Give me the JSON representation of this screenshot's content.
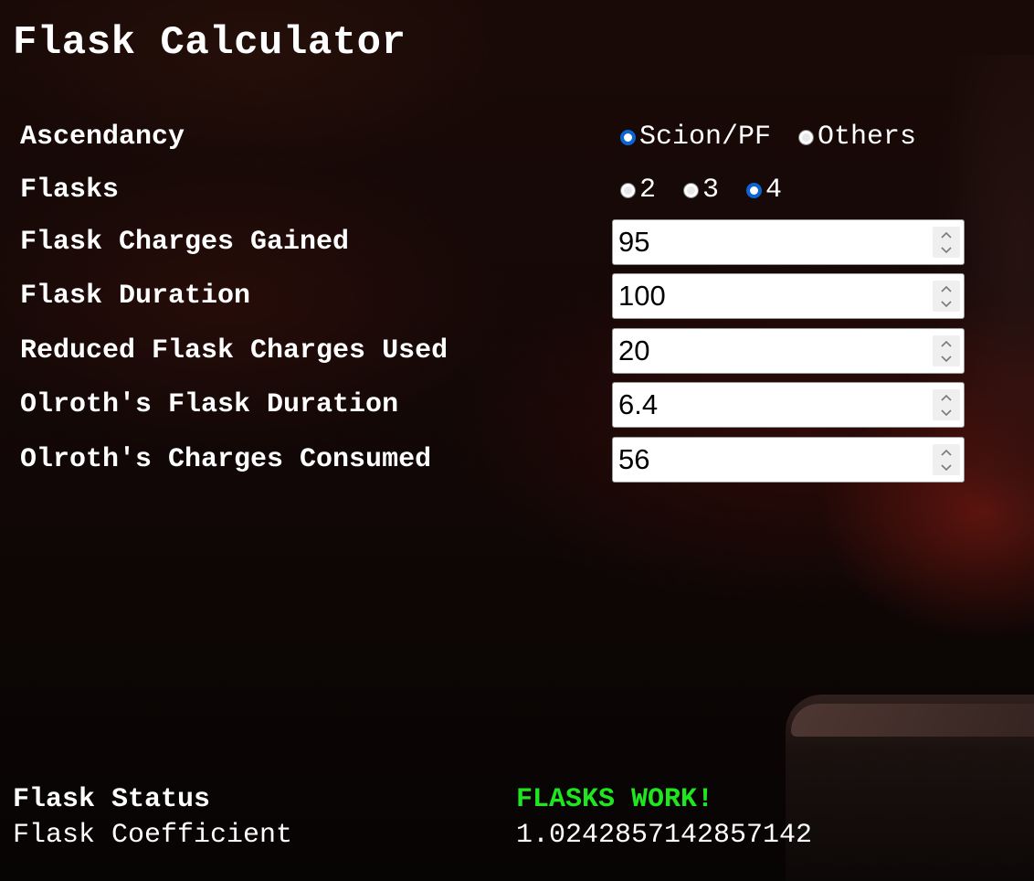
{
  "page_title": "Flask Calculator",
  "colors": {
    "status_ok": "#1fe61f",
    "radio_accent": "#0a64d2",
    "text": "#ffffff"
  },
  "ascendancy": {
    "label": "Ascendancy",
    "options": [
      "Scion/PF",
      "Others"
    ],
    "selected": "Scion/PF"
  },
  "flasks": {
    "label": "Flasks",
    "options": [
      "2",
      "3",
      "4"
    ],
    "selected": "4"
  },
  "fields": {
    "charges_gained": {
      "label": "Flask Charges Gained",
      "value": "95"
    },
    "duration": {
      "label": "Flask Duration",
      "value": "100"
    },
    "reduced_charges_used": {
      "label": "Reduced Flask Charges Used",
      "value": "20"
    },
    "olroth_duration": {
      "label": "Olroth's Flask Duration",
      "value": "6.4"
    },
    "olroth_charges": {
      "label": "Olroth's Charges Consumed",
      "value": "56"
    }
  },
  "results": {
    "status_label": "Flask Status",
    "status_value": "FLASKS WORK!",
    "coefficient_label": "Flask Coefficient",
    "coefficient_value": "1.0242857142857142"
  },
  "icons": {
    "spinner": "chevron-up-down-icon",
    "radio": "radio-dot-icon"
  }
}
